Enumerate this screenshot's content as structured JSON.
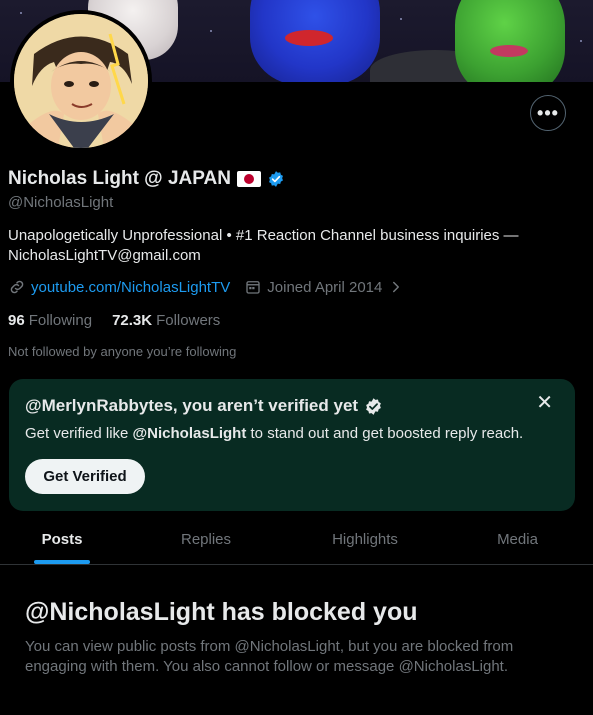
{
  "profile": {
    "name": "Nicholas Light @ JAPAN",
    "handle": "@NicholasLight",
    "bio": "Unapologetically Unprofessional • #1 Reaction Channel business inquiries — NicholasLightTV@gmail.com",
    "website": "youtube.com/NicholasLightTV",
    "joined": "Joined April 2014",
    "following_count": "96",
    "following_label": "Following",
    "followers_count": "72.3K",
    "followers_label": "Followers",
    "not_followed_text": "Not followed by anyone you’re following",
    "verified": true
  },
  "icons": {
    "more": "more-horizontal-icon",
    "link": "link-icon",
    "calendar": "calendar-icon",
    "chevron": "chevron-right-icon",
    "verified": "verified-badge-icon",
    "close": "close-icon",
    "flag": "japan-flag-icon"
  },
  "verify_card": {
    "title": "@MerlynRabbytes, you aren’t verified yet",
    "text_prefix": "Get verified like ",
    "text_handle": "@NicholasLight",
    "text_suffix": " to stand out and get boosted reply reach.",
    "button_label": "Get Verified",
    "close_glyph": "✕"
  },
  "tabs": [
    {
      "label": "Posts",
      "active": true
    },
    {
      "label": "Replies",
      "active": false
    },
    {
      "label": "Highlights",
      "active": false
    },
    {
      "label": "Media",
      "active": false
    }
  ],
  "blocked": {
    "title": "@NicholasLight has blocked you",
    "text": "You can view public posts from @NicholasLight, but you are blocked from engaging with them. You also cannot follow or message @NicholasLight."
  },
  "colors": {
    "accent": "#1d9bf0",
    "card_bg": "#082b22",
    "muted": "#71767b",
    "text": "#e7e9ea"
  }
}
